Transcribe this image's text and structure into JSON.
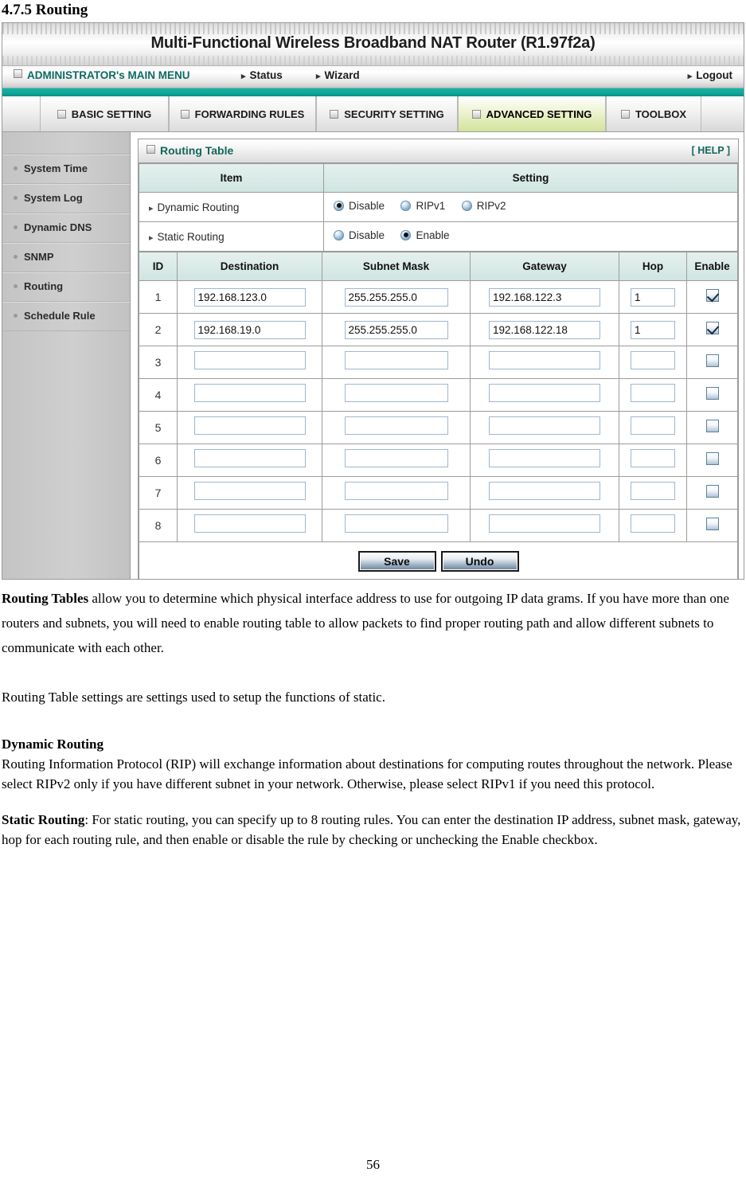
{
  "section": {
    "heading": "4.7.5 Routing"
  },
  "router_ui": {
    "banner_title": "Multi-Functional Wireless Broadband NAT Router (R1.97f2a)",
    "admin_bar": {
      "main_menu": "ADMINISTRATOR's MAIN MENU",
      "status": "Status",
      "wizard": "Wizard",
      "logout": "Logout"
    },
    "tabs": [
      {
        "label": "BASIC SETTING",
        "active": false
      },
      {
        "label": "FORWARDING RULES",
        "active": false
      },
      {
        "label": "SECURITY SETTING",
        "active": false
      },
      {
        "label": "ADVANCED SETTING",
        "active": true
      },
      {
        "label": "TOOLBOX",
        "active": false
      }
    ],
    "sidebar": [
      {
        "label": "System Time"
      },
      {
        "label": "System Log"
      },
      {
        "label": "Dynamic DNS"
      },
      {
        "label": "SNMP"
      },
      {
        "label": "Routing"
      },
      {
        "label": "Schedule Rule"
      }
    ],
    "panel": {
      "title": "Routing Table",
      "help": "[ HELP ]",
      "col_item": "Item",
      "col_setting": "Setting",
      "dynamic_routing": {
        "label": "Dynamic Routing",
        "options": [
          {
            "label": "Disable",
            "selected": true
          },
          {
            "label": "RIPv1",
            "selected": false
          },
          {
            "label": "RIPv2",
            "selected": false
          }
        ]
      },
      "static_routing": {
        "label": "Static Routing",
        "options": [
          {
            "label": "Disable",
            "selected": false
          },
          {
            "label": "Enable",
            "selected": true
          }
        ]
      },
      "table_headers": [
        "ID",
        "Destination",
        "Subnet Mask",
        "Gateway",
        "Hop",
        "Enable"
      ],
      "rows": [
        {
          "id": "1",
          "destination": "192.168.123.0",
          "subnet_mask": "255.255.255.0",
          "gateway": "192.168.122.3",
          "hop": "1",
          "enable": true
        },
        {
          "id": "2",
          "destination": "192.168.19.0",
          "subnet_mask": "255.255.255.0",
          "gateway": "192.168.122.18",
          "hop": "1",
          "enable": true
        },
        {
          "id": "3",
          "destination": "",
          "subnet_mask": "",
          "gateway": "",
          "hop": "",
          "enable": false
        },
        {
          "id": "4",
          "destination": "",
          "subnet_mask": "",
          "gateway": "",
          "hop": "",
          "enable": false
        },
        {
          "id": "5",
          "destination": "",
          "subnet_mask": "",
          "gateway": "",
          "hop": "",
          "enable": false
        },
        {
          "id": "6",
          "destination": "",
          "subnet_mask": "",
          "gateway": "",
          "hop": "",
          "enable": false
        },
        {
          "id": "7",
          "destination": "",
          "subnet_mask": "",
          "gateway": "",
          "hop": "",
          "enable": false
        },
        {
          "id": "8",
          "destination": "",
          "subnet_mask": "",
          "gateway": "",
          "hop": "",
          "enable": false
        }
      ],
      "save_label": "Save",
      "undo_label": "Undo"
    },
    "colors": {
      "accent_teal": "#0fa99b",
      "heading_green": "#15665c",
      "active_tab_green": "#d3e39a",
      "field_border_blue": "#9fb6d0"
    }
  },
  "prose": {
    "p1_bold": "Routing Tables",
    "p1_rest": " allow you to determine which physical interface address to use for outgoing IP data grams. If you have more than one routers and subnets, you will need to enable routing table to allow packets to find proper routing path and allow different subnets to communicate with each other.",
    "p2": "Routing Table settings are settings used to setup the functions of static.",
    "h_dynamic": "Dynamic Routing",
    "p3": "Routing Information Protocol (RIP) will exchange information about destinations for computing routes throughout the network. Please select RIPv2 only if you have different subnet in your network. Otherwise, please select RIPv1 if you need this protocol.",
    "p4_bold": "Static Routing",
    "p4_rest": ": For static routing, you can specify up to 8 routing rules. You can enter the destination IP address, subnet mask, gateway, hop for each routing rule, and then enable or disable the rule by checking or unchecking the Enable checkbox."
  },
  "footer": {
    "page_number": "56"
  }
}
